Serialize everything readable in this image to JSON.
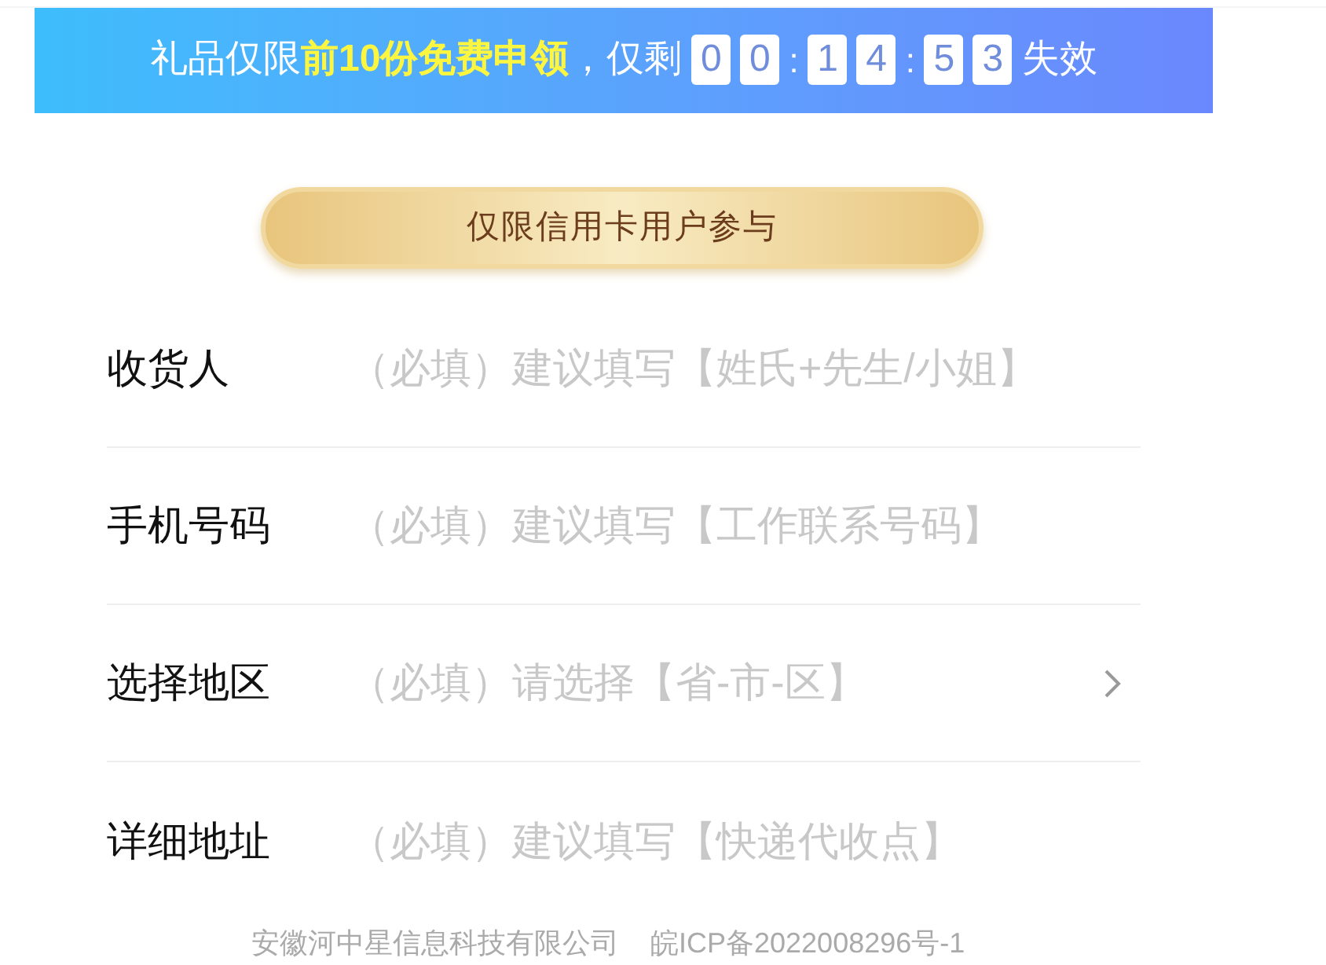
{
  "banner": {
    "text": "礼品仅限**前10份免费申领**，仅剩",
    "countdown": [
      {
        "kind": "digit",
        "text": "0"
      },
      {
        "kind": "digit",
        "text": "0"
      },
      {
        "kind": "sep",
        "text": ":"
      },
      {
        "kind": "digit",
        "text": "1"
      },
      {
        "kind": "digit",
        "text": "4"
      },
      {
        "kind": "sep",
        "text": ":"
      },
      {
        "kind": "digit",
        "text": "5"
      },
      {
        "kind": "digit",
        "text": "3"
      }
    ],
    "suffix": "失效"
  },
  "notice_button": "仅限信用卡用户参与",
  "form": [
    {
      "label": "收货人",
      "placeholder": "（必填）建议填写【姓氏+先生/小姐】",
      "kind": "text"
    },
    {
      "label": "手机号码",
      "placeholder": "（必填）建议填写【工作联系号码】",
      "kind": "text"
    },
    {
      "label": "选择地区",
      "placeholder": "（必填）请选择【省-市-区】",
      "kind": "select"
    },
    {
      "label": "详细地址",
      "placeholder": "（必填）建议填写【快递代收点】",
      "kind": "text"
    }
  ],
  "footer": "安徽河中星信息科技有限公司    皖ICP备2022008296号-1"
}
